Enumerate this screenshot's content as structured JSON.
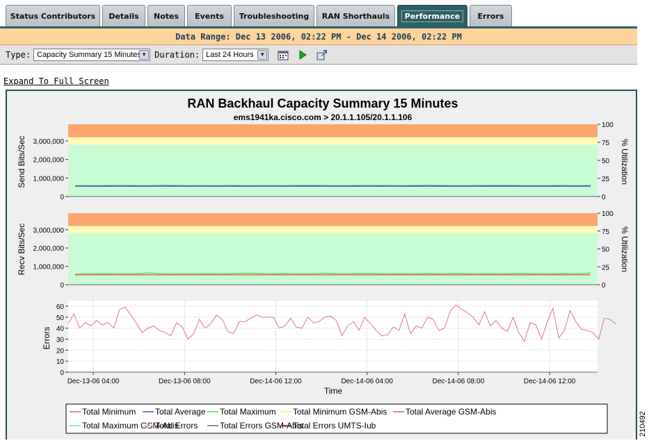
{
  "tabs": [
    {
      "label": "Status Contributors",
      "active": false
    },
    {
      "label": "Details",
      "active": false
    },
    {
      "label": "Notes",
      "active": false
    },
    {
      "label": "Events",
      "active": false
    },
    {
      "label": "Troubleshooting",
      "active": false
    },
    {
      "label": "RAN Shorthauls",
      "active": false
    },
    {
      "label": "Performance",
      "active": true
    },
    {
      "label": "Errors",
      "active": false
    }
  ],
  "date_range": "Data Range: Dec 13 2006, 02:22 PM - Dec 14 2006, 02:22 PM",
  "controls": {
    "type_label": "Type:",
    "type_value": "Capacity Summary 15 Minutes",
    "duration_label": "Duration:",
    "duration_value": "Last 24 Hours",
    "icons": [
      "calendar-icon",
      "play-icon",
      "export-icon"
    ]
  },
  "expand_link": "Expand To Full Screen",
  "figure_id": "210492",
  "colors": {
    "tab_active": "#2d5f66",
    "band_orange": "#fca56e",
    "band_yellow": "#fffab8",
    "band_green": "#c8fcd4",
    "total_minimum": "#e8665e",
    "total_average": "#5050c8",
    "total_maximum": "#5cd85c",
    "total_minimum_gsm": "#f0f060",
    "total_average_gsm": "#d050d0",
    "total_maximum_gsm": "#70d8e8",
    "total_errors": "#f4a8b8",
    "total_errors_gsm": "#8c5a72",
    "total_errors_umts": "#8c1a2a"
  },
  "chart_data": [
    {
      "type": "area",
      "title": "RAN Backhaul Capacity Summary 15 Minutes",
      "subtitle": "ems1941ka.cisco.com > 20.1.1.105/20.1.1.106",
      "ylabel": "Send Bits/Sec",
      "y2label": "% Utilization",
      "ylim": [
        0,
        3900000
      ],
      "yticks": [
        0,
        1000000,
        2000000,
        3000000
      ],
      "ytick_labels": [
        "0",
        "1,000,000",
        "2,000,000",
        "3,000,000"
      ],
      "y2lim": [
        0,
        100
      ],
      "y2ticks": [
        0,
        25,
        50,
        75,
        100
      ],
      "y2tick_labels": [
        "0",
        "25",
        "50",
        "75",
        "100"
      ],
      "bands": [
        {
          "from": 0,
          "to": 2800000,
          "color": "green"
        },
        {
          "from": 2800000,
          "to": 3200000,
          "color": "yellow"
        },
        {
          "from": 3200000,
          "to": 3900000,
          "color": "orange"
        }
      ],
      "series": [
        {
          "name": "Total Maximum",
          "values": [
            580000,
            590000,
            600000,
            595000,
            600000,
            590000,
            610000,
            600000,
            585000,
            590000,
            595000,
            600000,
            590000,
            585000,
            590000,
            600000,
            605000,
            595000,
            590000,
            600000,
            595000,
            600000,
            590000,
            600000,
            610000,
            600000,
            590000,
            595000,
            600000,
            605000,
            600000,
            590000,
            595000,
            600000,
            590000,
            600000
          ]
        },
        {
          "name": "Total Average",
          "values": [
            560000,
            560000,
            560000,
            560000,
            560000,
            560000,
            560000,
            560000,
            560000,
            560000,
            560000,
            560000,
            560000,
            560000,
            560000,
            560000,
            560000,
            560000,
            560000,
            560000,
            560000,
            560000,
            560000,
            560000,
            560000,
            560000,
            560000,
            560000,
            560000,
            560000,
            560000,
            560000,
            560000,
            560000,
            560000,
            560000
          ]
        }
      ]
    },
    {
      "type": "area",
      "ylabel": "Recv Bits/Sec",
      "y2label": "% Utilization",
      "ylim": [
        0,
        3900000
      ],
      "yticks": [
        0,
        1000000,
        2000000,
        3000000
      ],
      "ytick_labels": [
        "0",
        "1,000,000",
        "2,000,000",
        "3,000,000"
      ],
      "y2lim": [
        0,
        100
      ],
      "y2ticks": [
        0,
        25,
        50,
        75,
        100
      ],
      "y2tick_labels": [
        "0",
        "25",
        "50",
        "75",
        "100"
      ],
      "bands": [
        {
          "from": 0,
          "to": 2800000,
          "color": "green"
        },
        {
          "from": 2800000,
          "to": 3200000,
          "color": "yellow"
        },
        {
          "from": 3200000,
          "to": 3900000,
          "color": "orange"
        }
      ],
      "series": [
        {
          "name": "Total Maximum",
          "values": [
            580000,
            600000,
            610000,
            600000,
            590000,
            640000,
            600000,
            595000,
            600000,
            610000,
            600000,
            620000,
            630000,
            600000,
            610000,
            600000,
            595000,
            630000,
            600000,
            610000,
            620000,
            600000,
            605000,
            600000,
            610000,
            600000,
            620000,
            600000,
            610000,
            600000,
            620000,
            605000,
            600000,
            610000,
            600000,
            640000
          ]
        },
        {
          "name": "Total Minimum",
          "values": [
            540000,
            540000,
            540000,
            540000,
            540000,
            540000,
            540000,
            540000,
            540000,
            540000,
            540000,
            540000,
            540000,
            540000,
            540000,
            540000,
            540000,
            540000,
            540000,
            540000,
            540000,
            540000,
            540000,
            540000,
            540000,
            540000,
            540000,
            540000,
            540000,
            540000,
            540000,
            540000,
            540000,
            540000,
            540000,
            540000
          ]
        }
      ]
    },
    {
      "type": "line",
      "ylabel": "Errors",
      "xlabel": "Time",
      "ylim": [
        0,
        65
      ],
      "yticks": [
        0,
        10,
        20,
        30,
        40,
        50,
        60
      ],
      "x_tick_labels": [
        "Dec-13-06 04:00",
        "Dec-13-06 08:00",
        "Dec-14-06 12:00",
        "Dec-14-06 04:00",
        "Dec-14-06 08:00",
        "Dec-14-06 12:00"
      ],
      "x_tick_hours": [
        4,
        8,
        12,
        16,
        20,
        24
      ],
      "x_range_hours": [
        2.9,
        26.1
      ],
      "series": [
        {
          "name": "Total Errors",
          "x_step_hours": 0.25,
          "x_start_hours": 2.9,
          "values": [
            44,
            53,
            40,
            45,
            42,
            47,
            43,
            45,
            40,
            57,
            59,
            52,
            44,
            36,
            40,
            42,
            38,
            36,
            33,
            45,
            41,
            30,
            35,
            48,
            40,
            44,
            52,
            48,
            37,
            35,
            46,
            46,
            49,
            52,
            50,
            50,
            50,
            40,
            42,
            49,
            41,
            40,
            50,
            45,
            46,
            50,
            51,
            47,
            33,
            42,
            46,
            38,
            50,
            44,
            38,
            33,
            34,
            41,
            38,
            53,
            35,
            42,
            40,
            50,
            48,
            38,
            40,
            56,
            61,
            57,
            54,
            50,
            43,
            55,
            42,
            47,
            40,
            37,
            50,
            36,
            28,
            45,
            43,
            30,
            46,
            58,
            31,
            38,
            56,
            46,
            39,
            38,
            36,
            30,
            49,
            48,
            44
          ]
        }
      ]
    }
  ],
  "legend": [
    {
      "name": "Total Minimum",
      "color": "#e8665e"
    },
    {
      "name": "Total Average",
      "color": "#5050c8"
    },
    {
      "name": "Total Maximum",
      "color": "#5cd85c"
    },
    {
      "name": "Total Minimum GSM-Abis",
      "color": "#f0f060"
    },
    {
      "name": "Total Average GSM-Abis",
      "color": "#d050d0"
    },
    {
      "name": "Total Maximum GSM-Abis",
      "color": "#70d8e8"
    },
    {
      "name": "Total Errors",
      "color": "#f4a8b8"
    },
    {
      "name": "Total Errors GSM-Abis",
      "color": "#8c5a72"
    },
    {
      "name": "Total Errors UMTS-Iub",
      "color": "#8c1a2a"
    }
  ]
}
